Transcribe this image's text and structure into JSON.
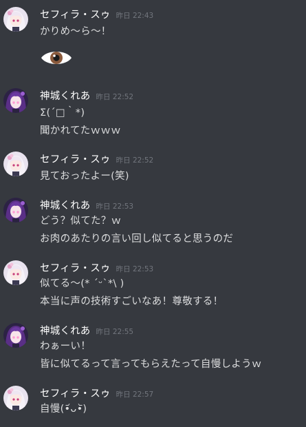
{
  "users": {
    "sephira": {
      "name": "セフィラ・スゥ",
      "avatar_icon": "sephira-avatar",
      "colors": {
        "hair": "#f1eaf3",
        "accent": "#e7a4c9",
        "eye": "#c73d7a",
        "bg": "#e9e3ef"
      }
    },
    "kurea": {
      "name": "神城くれあ",
      "avatar_icon": "kurea-avatar",
      "colors": {
        "hair": "#5a2f86",
        "accent": "#9b5fd1",
        "eye": "#ff9bd3",
        "bg": "#2c2244"
      }
    }
  },
  "messages": [
    {
      "user": "sephira",
      "author": "セフィラ・スゥ",
      "time": "昨日 22:43",
      "lines": [
        "かりめ～ら～！"
      ],
      "emoji": "eye-emoji"
    },
    {
      "user": "kurea",
      "author": "神城くれあ",
      "time": "昨日 22:52",
      "lines": [
        "Σ(´□｀*)",
        "聞かれてたｗｗｗ"
      ]
    },
    {
      "user": "sephira",
      "author": "セフィラ・スゥ",
      "time": "昨日 22:52",
      "lines": [
        "見ておったよー(笑)"
      ]
    },
    {
      "user": "kurea",
      "author": "神城くれあ",
      "time": "昨日 22:53",
      "lines": [
        "どう？似てた？ｗ",
        "お肉のあたりの言い回し似てると思うのだ"
      ]
    },
    {
      "user": "sephira",
      "author": "セフィラ・スゥ",
      "time": "昨日 22:53",
      "lines": [
        "似てる～(* ˊᵕˋ*\\ )",
        "本当に声の技術すごいなあ！尊敬する！"
      ]
    },
    {
      "user": "kurea",
      "author": "神城くれあ",
      "time": "昨日 22:55",
      "lines": [
        "わぁーい！",
        "皆に似てるって言ってもらえたって自慢しようｗ"
      ]
    },
    {
      "user": "sephira",
      "author": "セフィラ・スゥ",
      "time": "昨日 22:57",
      "lines": [
        "自慢(•᷄ᴗ•᷅)"
      ]
    }
  ],
  "theme": {
    "background": "#36393f",
    "author_color": "#ffffff",
    "timestamp_color": "#72767d",
    "text_color": "#dcddde"
  }
}
